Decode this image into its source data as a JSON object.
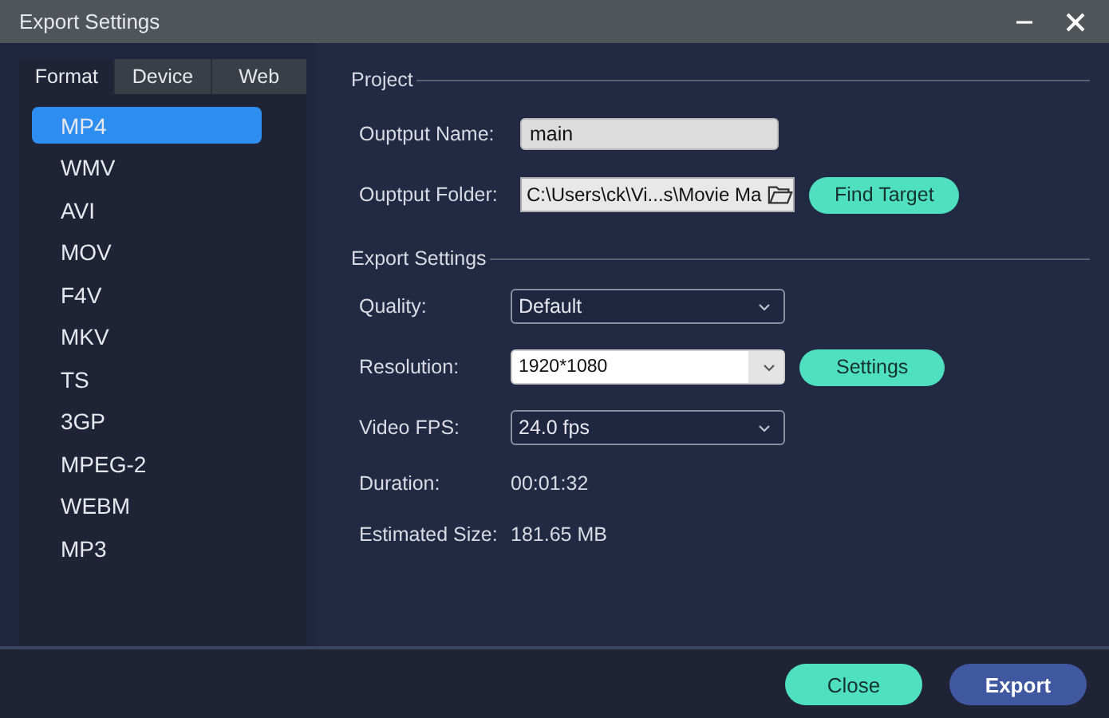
{
  "window": {
    "title": "Export Settings"
  },
  "tabs": [
    {
      "label": "Format",
      "selected": true
    },
    {
      "label": "Device",
      "selected": false
    },
    {
      "label": "Web",
      "selected": false
    }
  ],
  "formats": [
    {
      "label": "MP4",
      "selected": true
    },
    {
      "label": "WMV",
      "selected": false
    },
    {
      "label": "AVI",
      "selected": false
    },
    {
      "label": "MOV",
      "selected": false
    },
    {
      "label": "F4V",
      "selected": false
    },
    {
      "label": "MKV",
      "selected": false
    },
    {
      "label": "TS",
      "selected": false
    },
    {
      "label": "3GP",
      "selected": false
    },
    {
      "label": "MPEG-2",
      "selected": false
    },
    {
      "label": "WEBM",
      "selected": false
    },
    {
      "label": "MP3",
      "selected": false
    }
  ],
  "project": {
    "title": "Project",
    "output_name": {
      "label": "Ouptput Name:",
      "value": "main"
    },
    "output_folder": {
      "label": "Ouptput Folder:",
      "value": "C:\\Users\\ck\\Vi...s\\Movie Ma"
    },
    "find_target": "Find Target"
  },
  "export_settings": {
    "title": "Export Settings",
    "dropdowns": [
      {
        "label": "Quality:",
        "value": "Default",
        "kind": "select"
      },
      {
        "label": "Resolution:",
        "value": "1920*1080",
        "kind": "editable",
        "button": "Settings"
      },
      {
        "label": "Video FPS:",
        "value": "24.0 fps",
        "kind": "select"
      }
    ],
    "info": [
      {
        "label": "Duration:",
        "value": "00:01:32"
      },
      {
        "label": "Estimated Size:",
        "value": "181.65 MB"
      }
    ]
  },
  "buttons": {
    "close": "Close",
    "export": "Export"
  }
}
